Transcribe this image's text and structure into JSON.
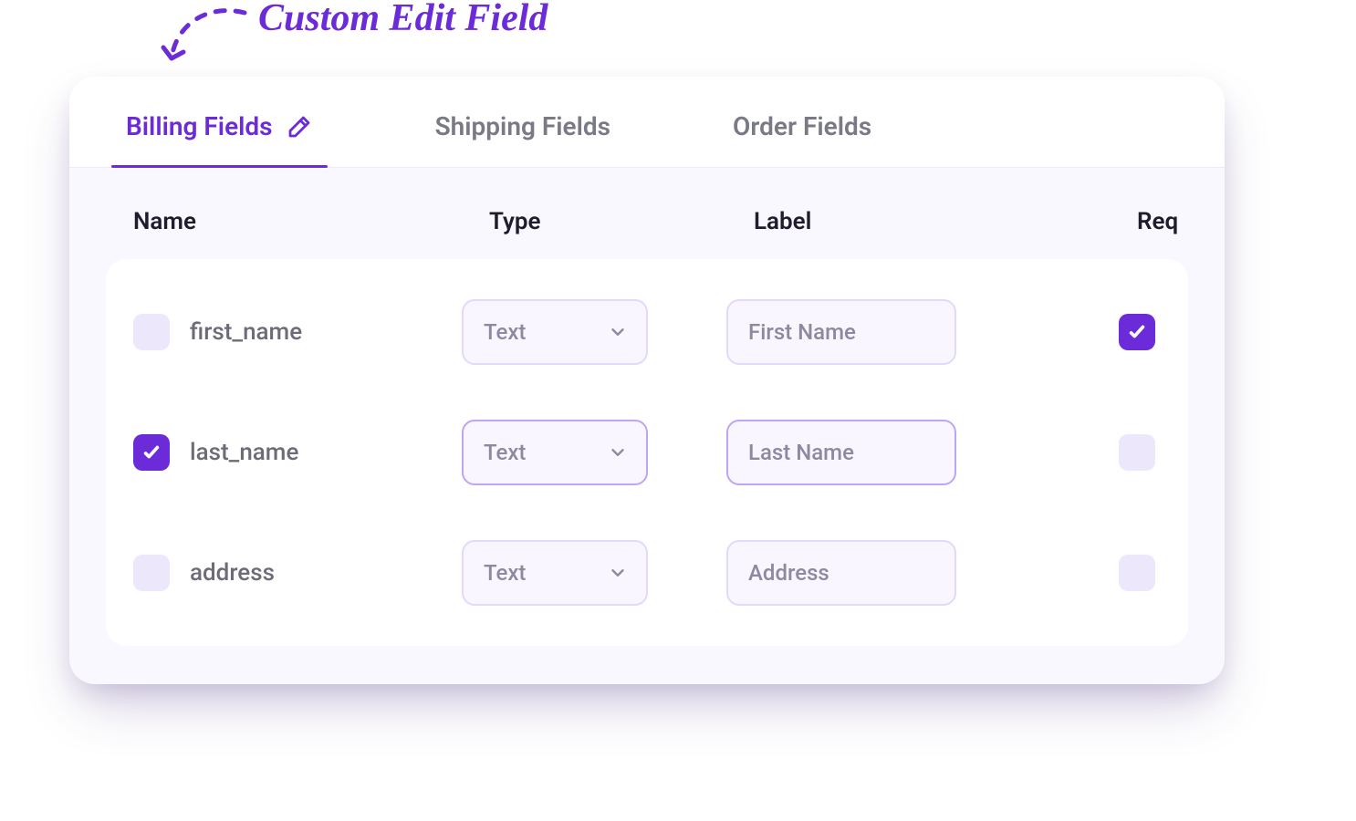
{
  "annotation": {
    "text": "Custom Edit Field"
  },
  "tabs": {
    "billing": "Billing Fields",
    "shipping": "Shipping Fields",
    "order": "Order Fields",
    "active_index": 0
  },
  "columns": {
    "name": "Name",
    "type": "Type",
    "label": "Label",
    "req": "Req"
  },
  "rows": [
    {
      "name": "first_name",
      "selected": false,
      "type": "Text",
      "label": "First Name",
      "required": true
    },
    {
      "name": "last_name",
      "selected": true,
      "type": "Text",
      "label": "Last Name",
      "required": false
    },
    {
      "name": "address",
      "selected": false,
      "type": "Text",
      "label": "Address",
      "required": false
    }
  ],
  "colors": {
    "accent": "#6c2bd9",
    "muted_text": "#7a7a86",
    "field_border": "#e2d9fb",
    "field_border_focus": "#bca7f5",
    "field_bg": "#f9f6ff",
    "card_bg": "#f9f7ff",
    "check_unchecked_bg": "#ece7fb"
  }
}
